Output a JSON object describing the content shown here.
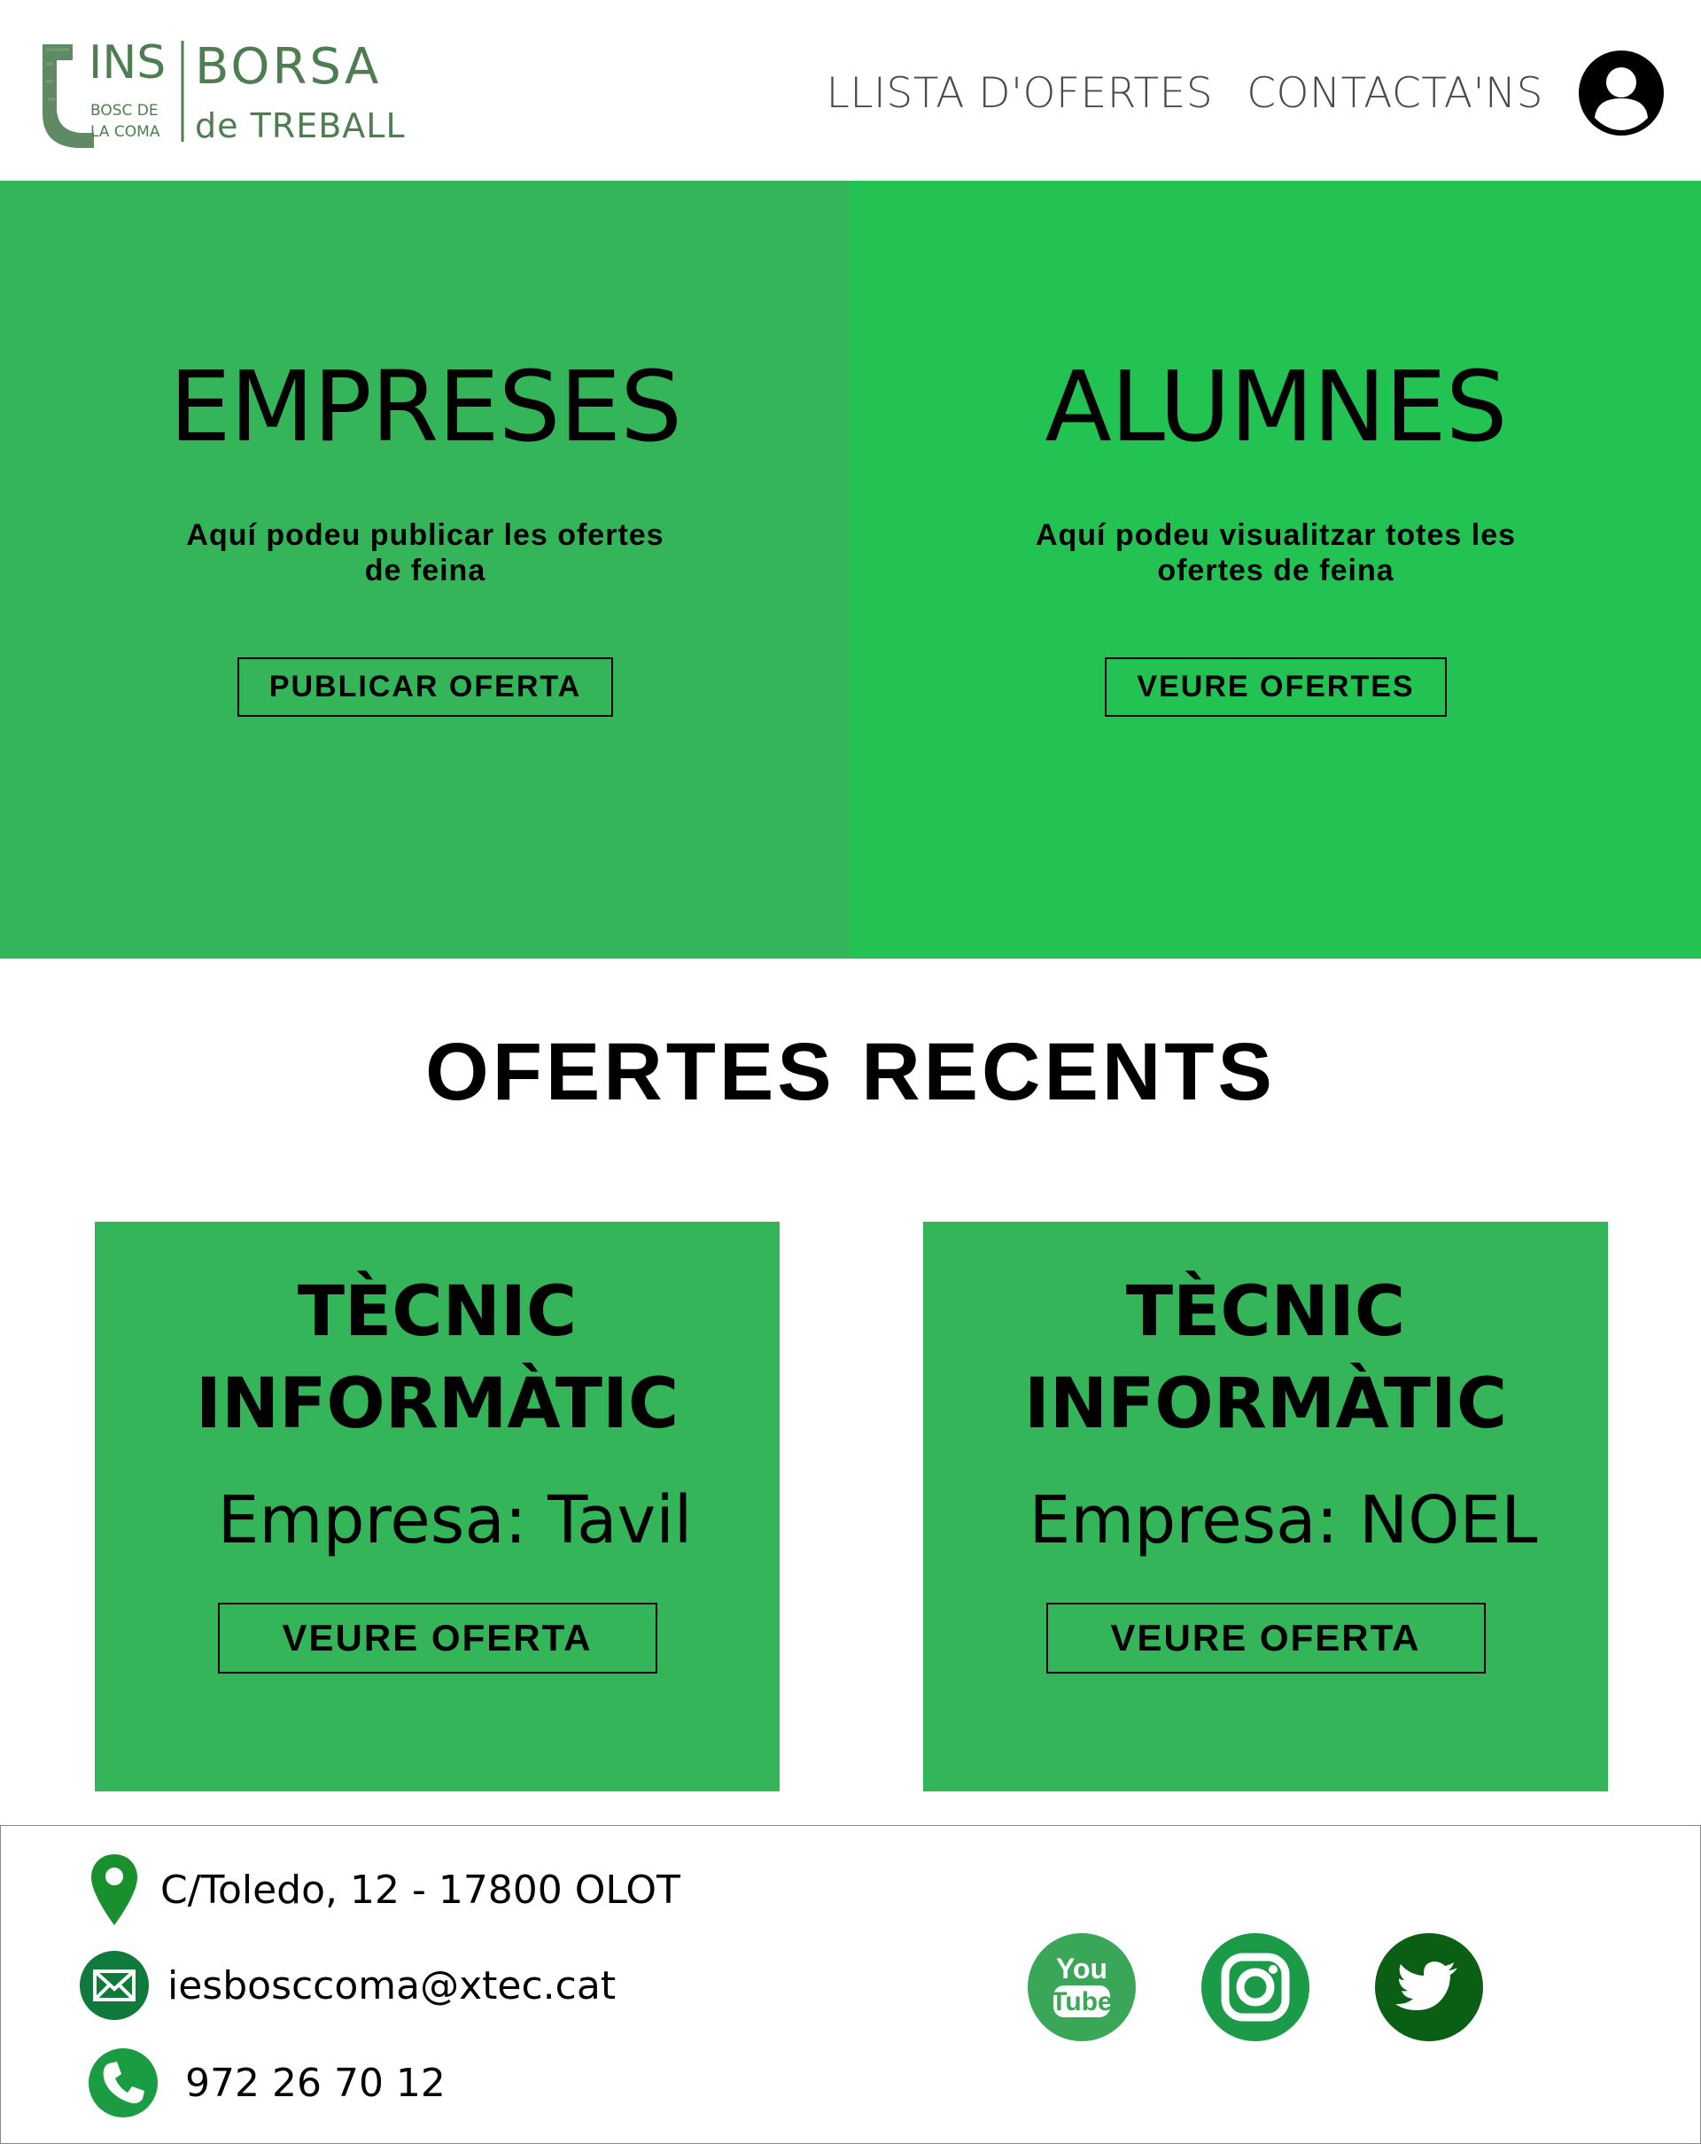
{
  "header": {
    "logo": {
      "ins": "INS",
      "school_line1": "BOSC DE",
      "school_line2": "LA COMA",
      "borsa": "BORSA",
      "de_treball": "de TREBALL"
    },
    "nav": [
      {
        "label": "LLISTA D'OFERTES"
      },
      {
        "label": "CONTACTA'NS"
      }
    ],
    "user_icon": "user-account-icon"
  },
  "hero": {
    "empreses": {
      "title": "EMPRESES",
      "text": "Aquí podeu publicar les ofertes de feina",
      "button": "PUBLICAR OFERTA",
      "color": "#34b55a"
    },
    "alumnes": {
      "title": "ALUMNES",
      "text": "Aquí podeu visualitzar totes les ofertes de feina",
      "button": "VEURE OFERTES",
      "color": "#22c353"
    }
  },
  "recent": {
    "title": "OFERTES RECENTS",
    "offers": [
      {
        "title_line1": "TÈCNIC",
        "title_line2": "INFORMÀTIC",
        "company": "Empresa: Tavil",
        "button": "VEURE OFERTA"
      },
      {
        "title_line1": "TÈCNIC",
        "title_line2": "INFORMÀTIC",
        "company": "Empresa: NOEL",
        "button": "VEURE OFERTA"
      }
    ]
  },
  "footer": {
    "address": "C/Toledo, 12 - 17800 OLOT",
    "email": "iesbosccoma@xtec.cat",
    "phone": "972 26 70 12",
    "social": [
      {
        "name": "youtube-icon",
        "line1": "You",
        "line2": "Tube"
      },
      {
        "name": "instagram-icon"
      },
      {
        "name": "twitter-icon"
      }
    ]
  }
}
